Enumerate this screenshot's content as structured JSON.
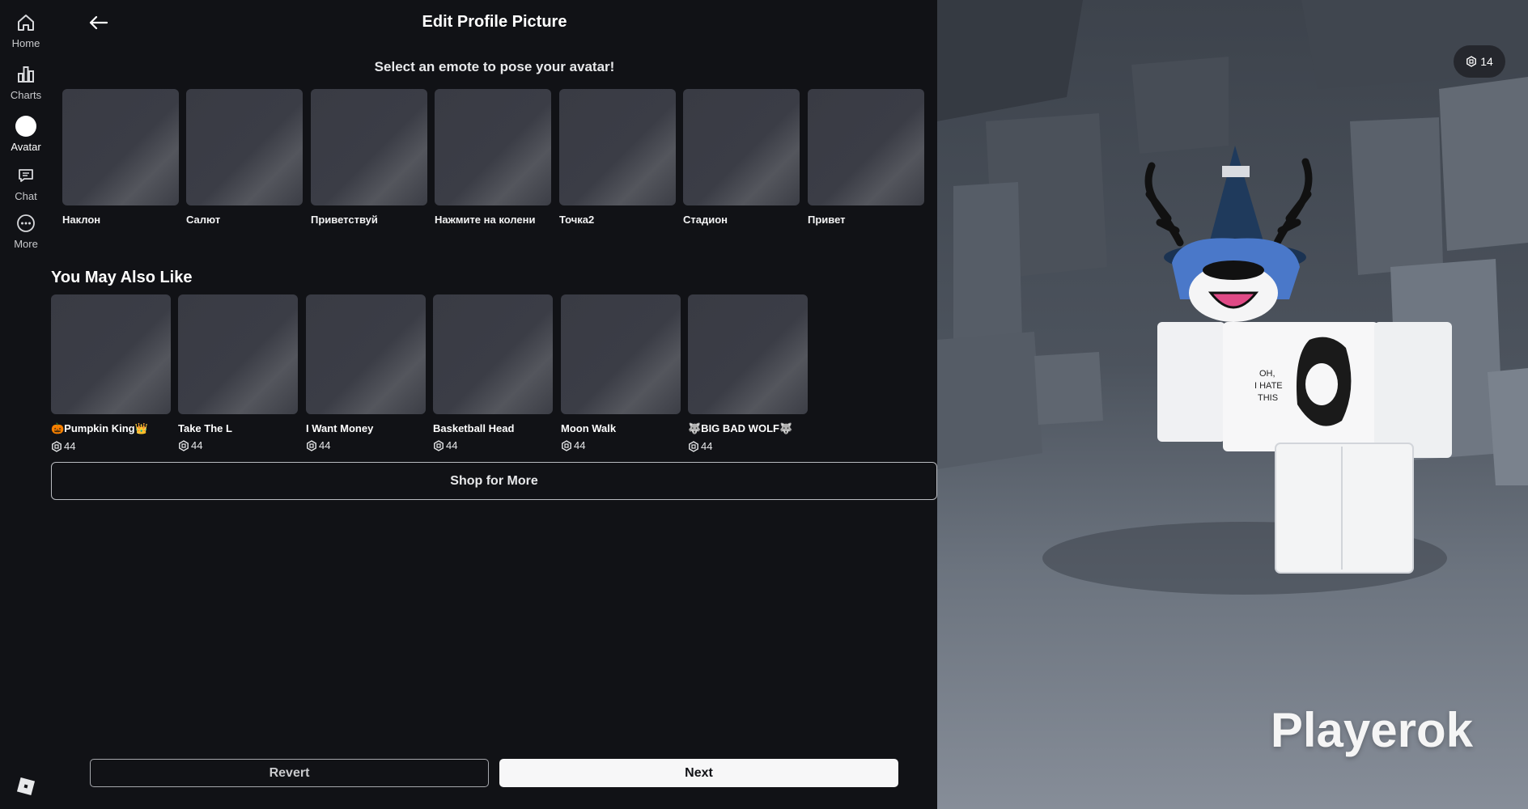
{
  "nav": {
    "items": [
      {
        "label": "Home",
        "icon": "home-icon"
      },
      {
        "label": "Charts",
        "icon": "charts-icon"
      },
      {
        "label": "Avatar",
        "icon": "avatar-icon",
        "active": true
      },
      {
        "label": "Chat",
        "icon": "chat-icon"
      },
      {
        "label": "More",
        "icon": "more-icon"
      }
    ]
  },
  "header": {
    "title": "Edit Profile Picture",
    "subtitle": "Select an emote to pose your avatar!"
  },
  "emotes": [
    "Наклон",
    "Салют",
    "Приветствуй",
    "Нажмите на колени",
    "Точка2",
    "Стадион",
    "Привет"
  ],
  "recommendations": {
    "title": "You May Also Like",
    "items": [
      {
        "name": "🎃Pumpkin King👑",
        "price": "44"
      },
      {
        "name": "Take The L",
        "price": "44"
      },
      {
        "name": "I Want Money",
        "price": "44"
      },
      {
        "name": "Basketball Head",
        "price": "44"
      },
      {
        "name": "Moon Walk",
        "price": "44"
      },
      {
        "name": "🐺BIG BAD WOLF🐺",
        "price": "44"
      }
    ],
    "shop_label": "Shop for More"
  },
  "actions": {
    "revert_label": "Revert",
    "next_label": "Next"
  },
  "preview": {
    "robux_balance": "14",
    "username": "Playerok",
    "shirt_text": [
      "OH,",
      "I HATE",
      "THIS"
    ]
  },
  "colors": {
    "background": "#111216",
    "tile": "#3b3d46",
    "next_button": "#f7f7f8",
    "hat": "#1f3a5c",
    "hair": "#4a78c9"
  }
}
